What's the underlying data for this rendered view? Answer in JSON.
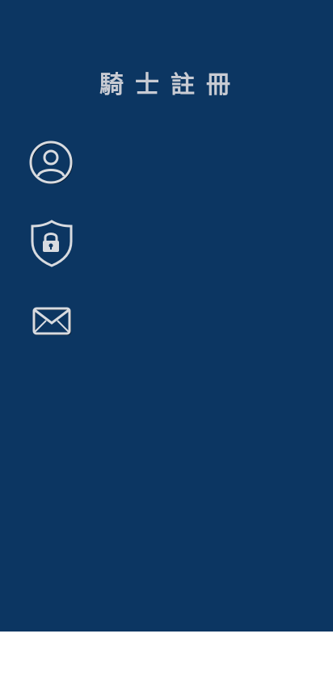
{
  "page": {
    "title": "騎士註冊"
  },
  "form": {
    "username": {
      "icon": "user-circle-icon",
      "value": "",
      "placeholder": ""
    },
    "password": {
      "icon": "shield-lock-icon",
      "value": "",
      "placeholder": ""
    },
    "email": {
      "icon": "envelope-icon",
      "value": "",
      "placeholder": ""
    }
  },
  "colors": {
    "background": "#0c3662",
    "title": "#c8cbd3",
    "icon": "#d8dbe0",
    "bottom": "#ffffff"
  }
}
